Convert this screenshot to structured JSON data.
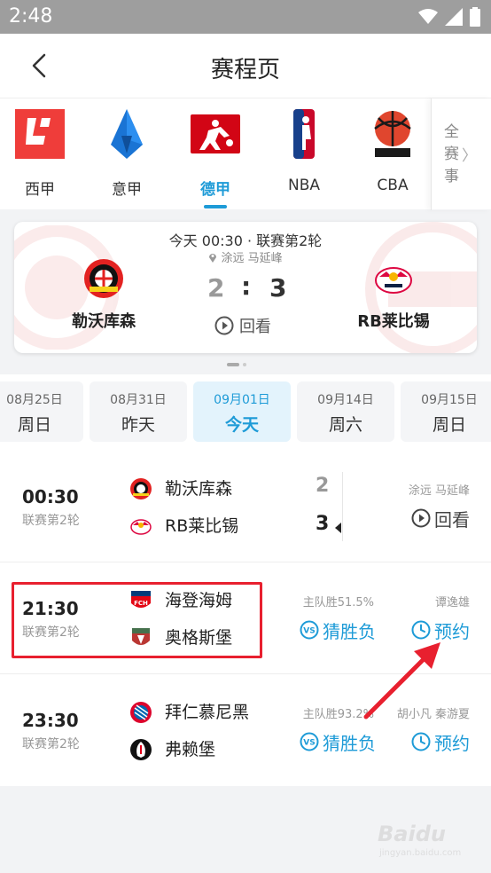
{
  "status": {
    "time": "2:48"
  },
  "header": {
    "title": "赛程页"
  },
  "leagues": {
    "items": [
      {
        "label": "西甲",
        "icon": "laliga-logo-icon"
      },
      {
        "label": "意甲",
        "icon": "serie-a-logo-icon"
      },
      {
        "label": "德甲",
        "icon": "bundesliga-logo-icon",
        "active": true
      },
      {
        "label": "NBA",
        "icon": "nba-logo-icon"
      },
      {
        "label": "CBA",
        "icon": "cba-logo-icon"
      }
    ],
    "all_label": "全赛事",
    "all_char1": "全",
    "all_char2": "赛",
    "all_char3": "事"
  },
  "featured": {
    "info": "今天 00:30 · 联赛第2轮",
    "venue": "涂远 马延峰",
    "home": "勒沃库森",
    "away": "RB莱比锡",
    "home_score": "2",
    "colon": ":",
    "away_score": "3",
    "replay": "回看"
  },
  "dates": [
    {
      "date": "08月25日",
      "weekday": "周日"
    },
    {
      "date": "08月31日",
      "weekday": "昨天"
    },
    {
      "date": "09月01日",
      "weekday": "今天",
      "active": true
    },
    {
      "date": "09月14日",
      "weekday": "周六"
    },
    {
      "date": "09月15日",
      "weekday": "周日"
    }
  ],
  "matches": [
    {
      "time": "00:30",
      "round": "联赛第2轮",
      "home": "勒沃库森",
      "away": "RB莱比锡",
      "home_score": "2",
      "away_score": "3",
      "commentator": "涂远 马延峰",
      "action": "回看"
    },
    {
      "time": "21:30",
      "round": "联赛第2轮",
      "home": "海登海姆",
      "away": "奥格斯堡",
      "prediction": "主队胜51.5%",
      "guess": "猜胜负",
      "commentator": "谭逸雄",
      "action": "预约"
    },
    {
      "time": "23:30",
      "round": "联赛第2轮",
      "home": "拜仁慕尼黑",
      "away": "弗赖堡",
      "prediction": "主队胜93.2%",
      "guess": "猜胜负",
      "commentator": "胡小凡 秦游夏",
      "action": "预约"
    }
  ],
  "watermark": {
    "brand": "Baidu",
    "sub": "jingyan.baidu.com"
  },
  "colors": {
    "accent": "#1e9bd7",
    "highlight": "#e8202f"
  }
}
